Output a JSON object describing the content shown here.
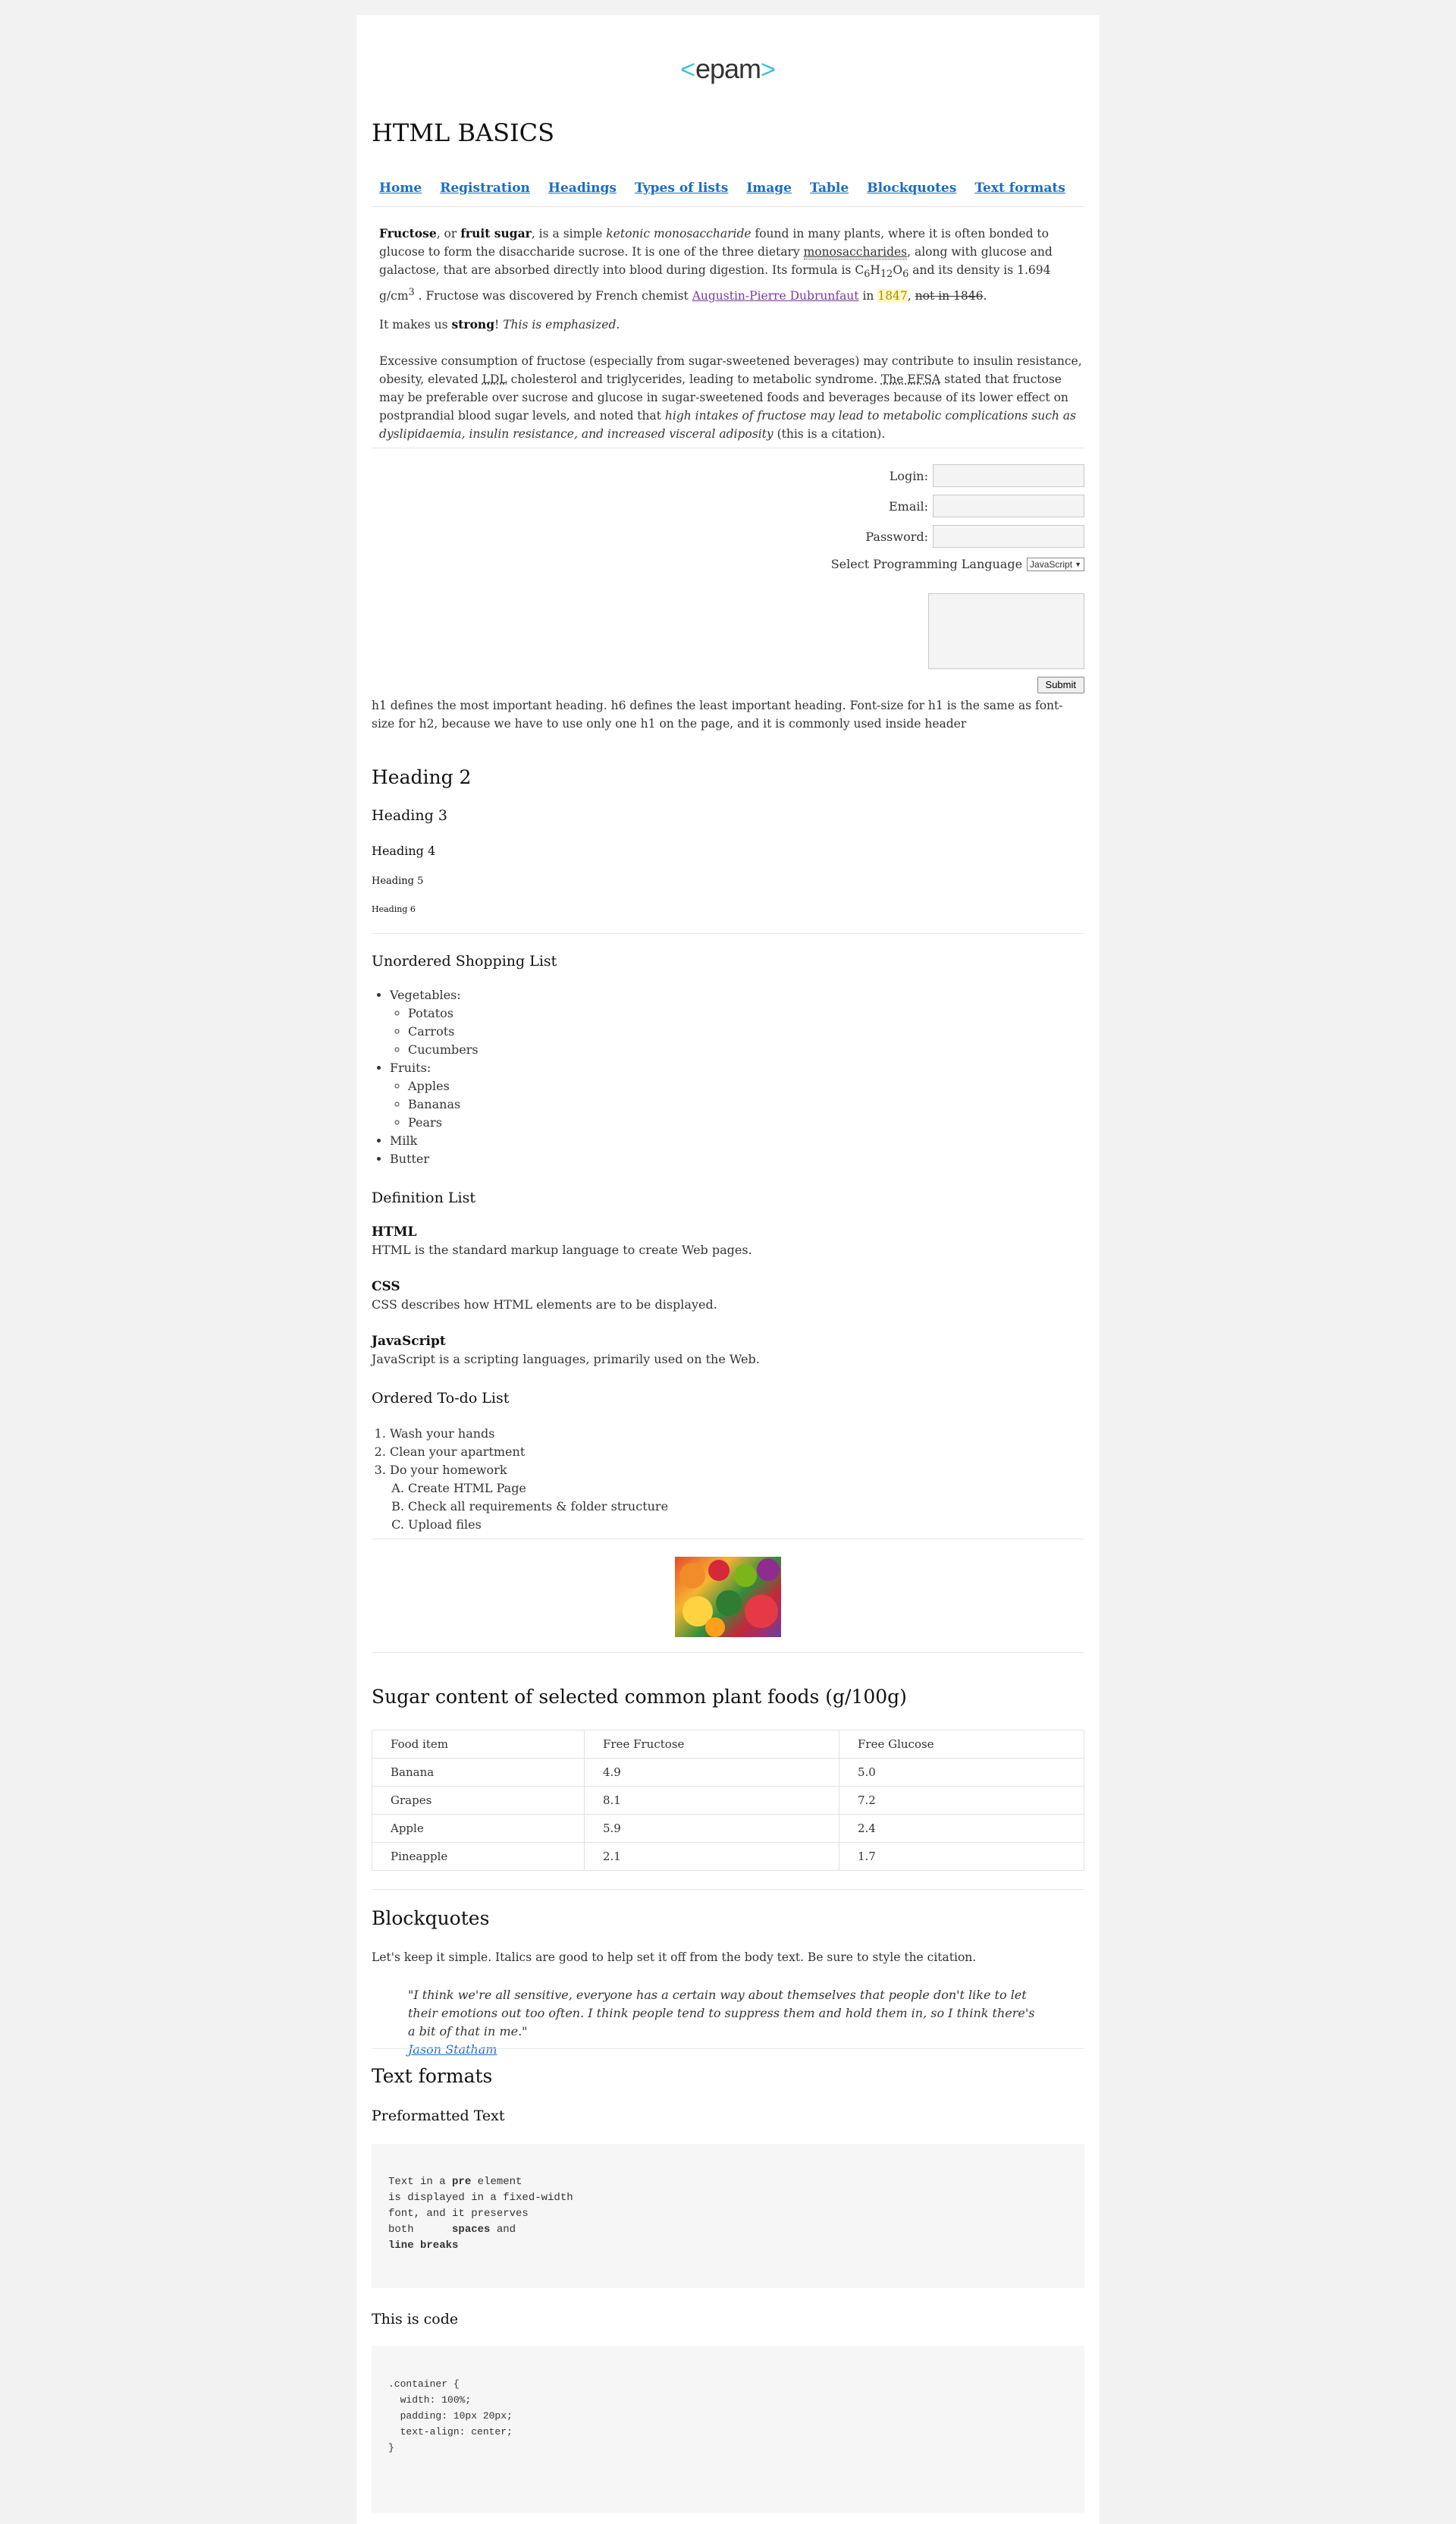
{
  "logo": {
    "text": "epam",
    "left": "<",
    "right": ">"
  },
  "site_title": "HTML BASICS",
  "nav": [
    "Home",
    "Registration",
    "Headings",
    "Types of lists",
    "Image",
    "Table",
    "Blockquotes",
    "Text formats"
  ],
  "intro": {
    "p1_part1_bold": "Fructose",
    "p1_part2": ", or ",
    "p1_part3_bold": "fruit sugar",
    "p1_part4": ", is a simple ",
    "p1_part5_italic": "ketonic monosaccharide",
    "p1_part6": " found in many plants, where it is often bonded to glucose to form the disaccharide sucrose. It is one of the three dietary ",
    "p1_abbr": "monosaccharides",
    "p1_part7": ", along with glucose and galactose, that are absorbed directly into blood during digestion. Its formula is C",
    "p1_sub1": "6",
    "p1_h": "H",
    "p1_sub2": "12",
    "p1_o": "O",
    "p1_sub3": "6",
    "p1_part8": " and its density is 1.694 g/cm",
    "p1_sup": "3",
    "p1_part9": " . Fructose was discovered by French chemist ",
    "p1_link": "Augustin-Pierre Dubrunfaut",
    "p1_in": " in ",
    "p1_year": "1847",
    "p1_comma": ", ",
    "p1_strike": "not in 1846",
    "p1_end": ".",
    "p2_a": "It makes us ",
    "p2_strong": "strong",
    "p2_b": "! ",
    "p2_em": "This is emphasized.",
    "p3_a": "Excessive consumption of fructose (especially from sugar-sweetened beverages) may contribute to insulin resistance, obesity, elevated ",
    "p3_ldl": "LDL",
    "p3_b": " cholesterol and triglycerides, leading to metabolic syndrome. ",
    "p3_efsa": "The EFSA",
    "p3_c": " stated that fructose may be preferable over sucrose and glucose in sugar-sweetened foods and beverages because of its lower effect on postprandial blood sugar levels, and noted that ",
    "p3_cite": "high intakes of fructose may lead to metabolic complications such as dyslipidaemia, insulin resistance, and increased visceral adiposity",
    "p3_d": " (this is a citation)."
  },
  "form": {
    "login_label": "Login:",
    "email_label": "Email:",
    "password_label": "Password:",
    "lang_label": "Select Programming Language",
    "lang_value": "JavaScript",
    "submit": "Submit"
  },
  "headings_note": "h1 defines the most important heading. h6 defines the least important heading. Font-size for h1 is the same as font-size for h2, because we have to use only one h1 on the page, and it is commonly used inside header",
  "headings": [
    "Heading 2",
    "Heading 3",
    "Heading 4",
    "Heading 5",
    "Heading 6"
  ],
  "unordered": {
    "title": "Unordered Shopping List",
    "vegetables": "Vegetables:",
    "veg_items": [
      "Potatos",
      "Carrots",
      "Cucumbers"
    ],
    "fruits": "Fruits:",
    "fruit_items": [
      "Apples",
      "Bananas",
      "Pears"
    ],
    "milk": "Milk",
    "butter": "Butter"
  },
  "definition": {
    "title": "Definition List",
    "items": [
      {
        "term": "HTML",
        "desc": "HTML is the standard markup language to create Web pages."
      },
      {
        "term": "CSS",
        "desc": "CSS describes how HTML elements are to be displayed."
      },
      {
        "term": "JavaScript",
        "desc": "JavaScript is a scripting languages, primarily used on the Web."
      }
    ]
  },
  "ordered": {
    "title": "Ordered To-do List",
    "items": [
      "Wash your hands",
      "Clean your apartment",
      "Do your homework"
    ],
    "sub_items": [
      "Create HTML Page",
      "Check all requirements & folder structure",
      "Upload files"
    ]
  },
  "table": {
    "title": "Sugar content of selected common plant foods (g/100g)",
    "header": [
      "Food item",
      "Free Fructose",
      "Free Glucose"
    ],
    "rows": [
      [
        "Banana",
        "4.9",
        "5.0"
      ],
      [
        "Grapes",
        "8.1",
        "7.2"
      ],
      [
        "Apple",
        "5.9",
        "2.4"
      ],
      [
        "Pineapple",
        "2.1",
        "1.7"
      ]
    ]
  },
  "blockquotes": {
    "title": "Blockquotes",
    "intro": "Let's keep it simple. Italics are good to help set it off from the body text. Be sure to style the citation.",
    "quote": "\"I think we're all sensitive, everyone has a certain way about themselves that people don't like to let their emotions out too often. I think people tend to suppress them and hold them in, so I think there's a bit of that in me.\"",
    "author": "Jason Statham"
  },
  "text_formats": {
    "title": "Text formats",
    "pre_title": "Preformatted Text",
    "pre_l1_a": "Text in a ",
    "pre_l1_b": "pre",
    "pre_l1_c": " element",
    "pre_l2": "is displayed in a fixed-width",
    "pre_l3": "font, and it preserves",
    "pre_l4_a": "both      ",
    "pre_l4_b": "spaces",
    "pre_l4_c": " and",
    "pre_l5": "line breaks",
    "code_title": "This is code",
    "code": ".container {\n  width: 100%;\n  padding: 10px 20px;\n  text-align: center;\n}"
  }
}
